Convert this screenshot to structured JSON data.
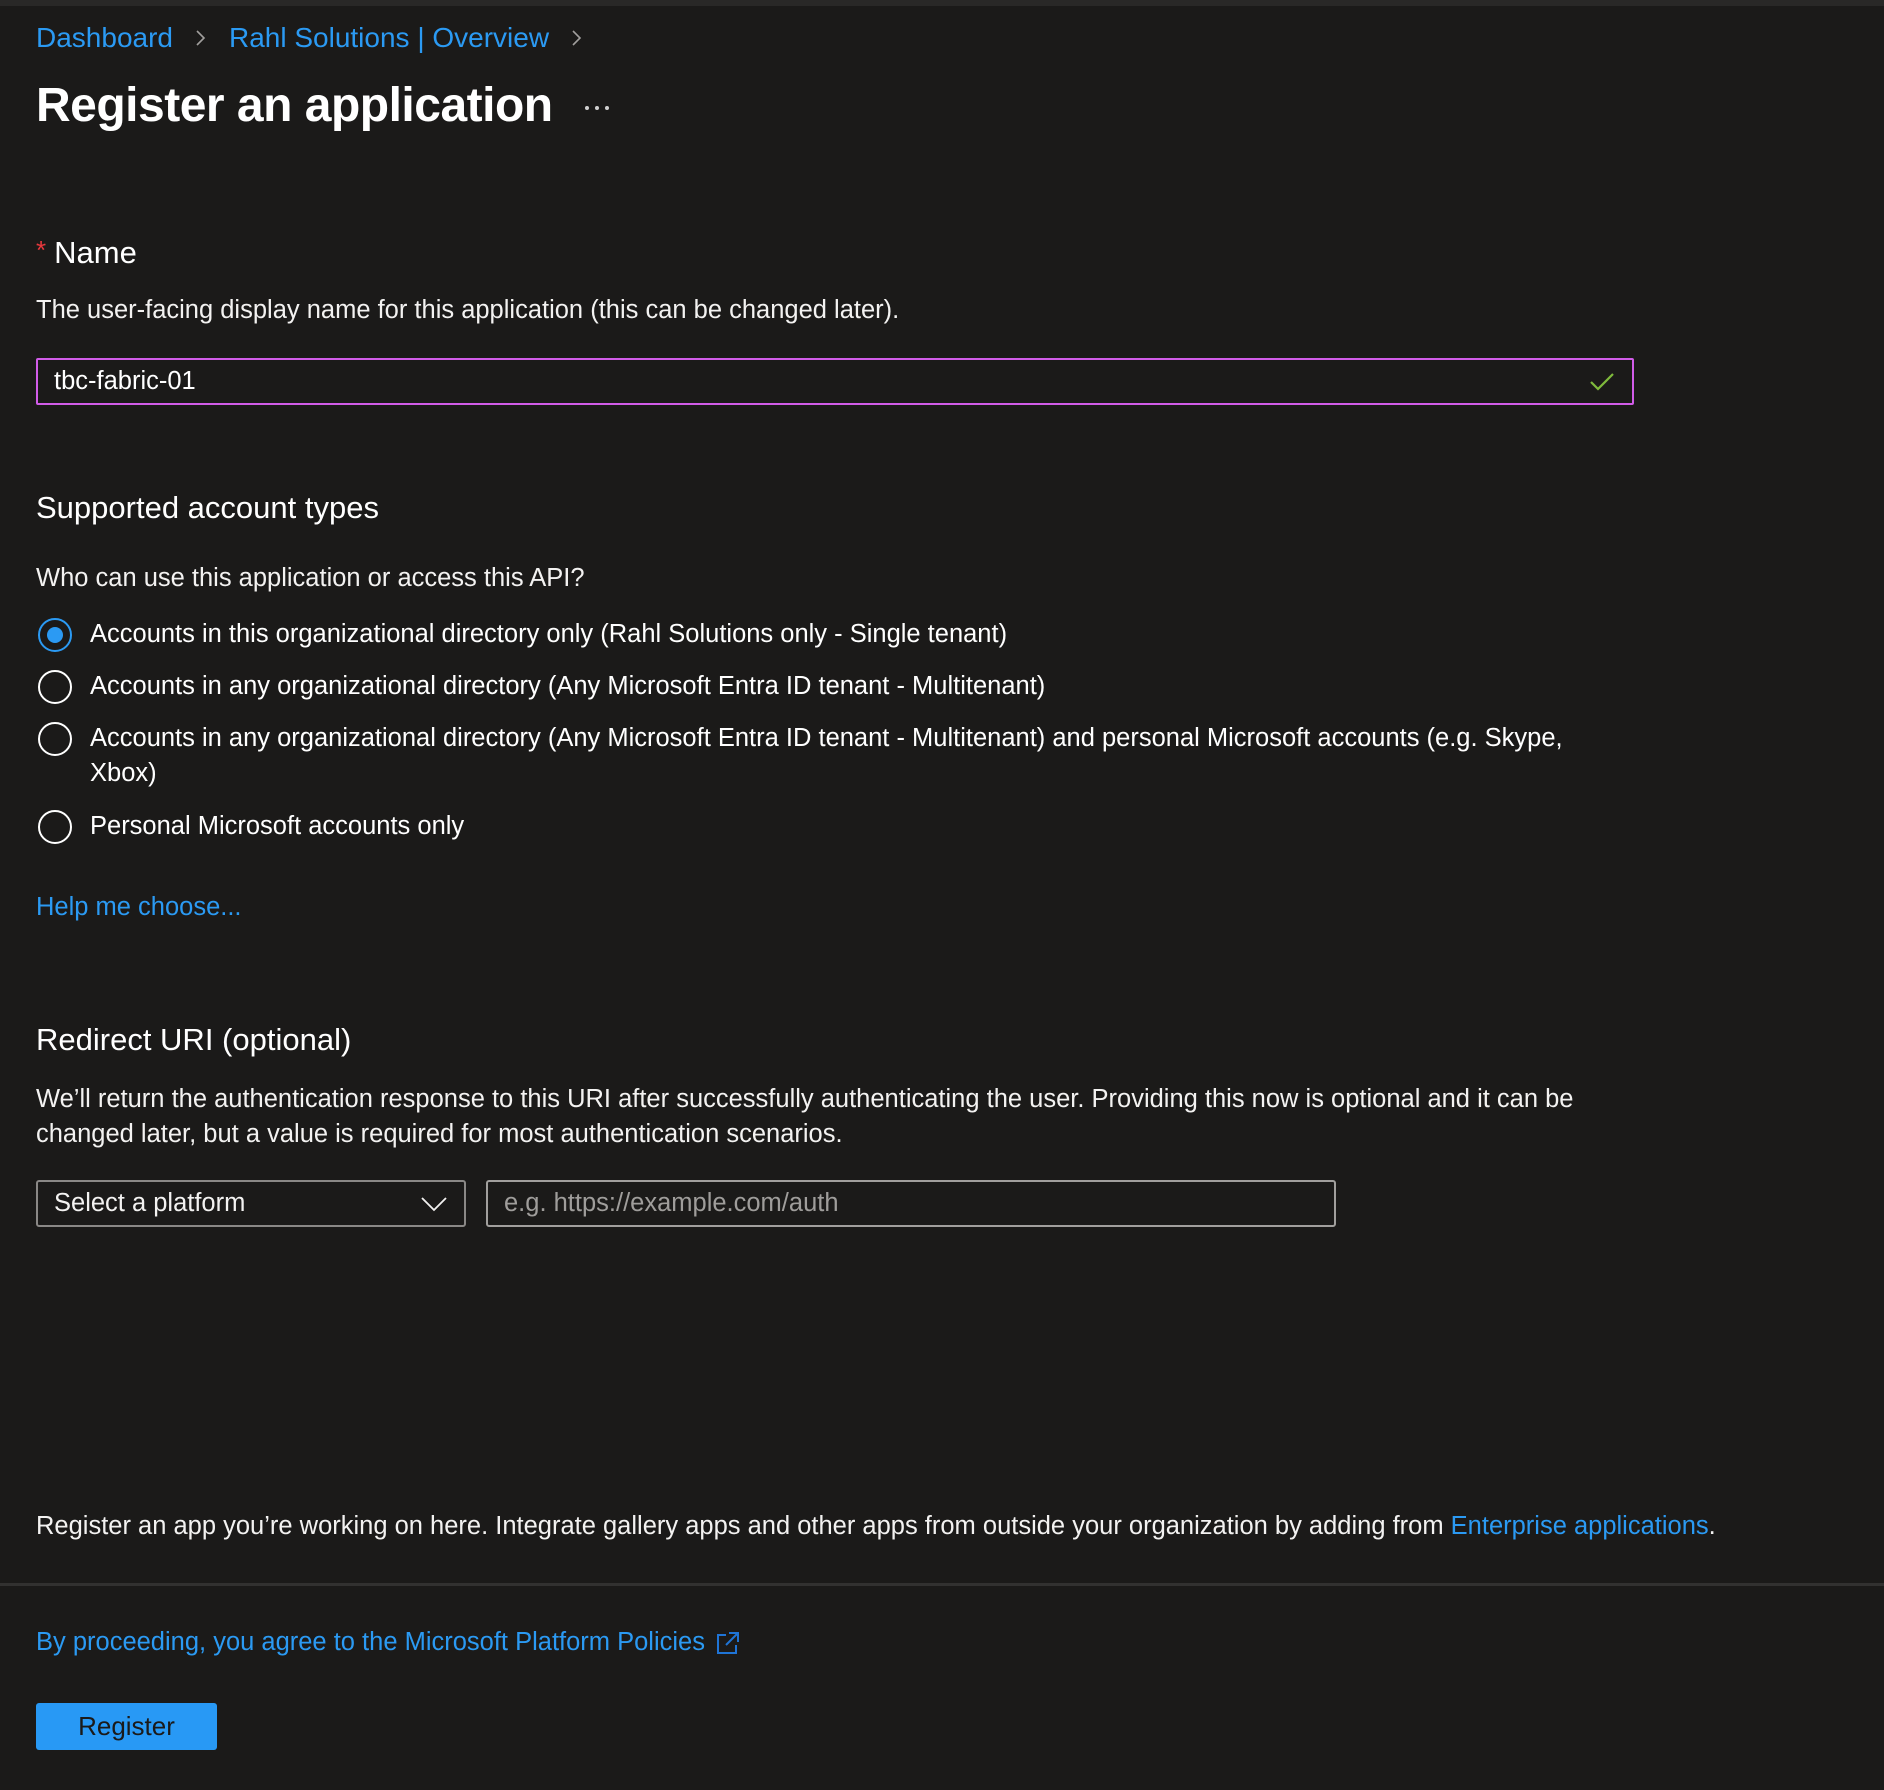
{
  "colors": {
    "background": "#1b1a19",
    "link": "#2b9af3",
    "focus_border": "#d15ce8",
    "valid_check": "#7fba3c",
    "primary_button": "#2899f5",
    "required_star": "#e8383d"
  },
  "breadcrumb": {
    "items": [
      {
        "label": "Dashboard"
      },
      {
        "label": "Rahl Solutions | Overview"
      }
    ],
    "separator_icon": "chevron-right-icon"
  },
  "header": {
    "title": "Register an application",
    "more_icon": "more-ellipsis-icon"
  },
  "name_section": {
    "required_marker": "*",
    "label": "Name",
    "description": "The user-facing display name for this application (this can be changed later).",
    "input_value": "tbc-fabric-01",
    "validation_icon": "checkmark-icon"
  },
  "account_types": {
    "heading": "Supported account types",
    "question": "Who can use this application or access this API?",
    "options": [
      {
        "label": "Accounts in this organizational directory only (Rahl Solutions only - Single tenant)",
        "selected": true
      },
      {
        "label": "Accounts in any organizational directory (Any Microsoft Entra ID tenant - Multitenant)",
        "selected": false
      },
      {
        "label": "Accounts in any organizational directory (Any Microsoft Entra ID tenant - Multitenant) and personal Microsoft accounts (e.g. Skype, Xbox)",
        "selected": false
      },
      {
        "label": "Personal Microsoft accounts only",
        "selected": false
      }
    ],
    "help_link": "Help me choose..."
  },
  "redirect_uri": {
    "heading": "Redirect URI (optional)",
    "description": "We’ll return the authentication response to this URI after successfully authenticating the user. Providing this now is optional and it can be changed later, but a value is required for most authentication scenarios.",
    "platform_select": "Select a platform",
    "uri_placeholder": "e.g. https://example.com/auth",
    "uri_value": ""
  },
  "footer": {
    "info_text": "Register an app you’re working on here. Integrate gallery apps and other apps from outside your organization by adding from ",
    "info_link": "Enterprise applications",
    "info_suffix": ".",
    "policy_link": "By proceeding, you agree to the Microsoft Platform Policies",
    "policy_icon": "external-link-icon",
    "register_button": "Register"
  }
}
